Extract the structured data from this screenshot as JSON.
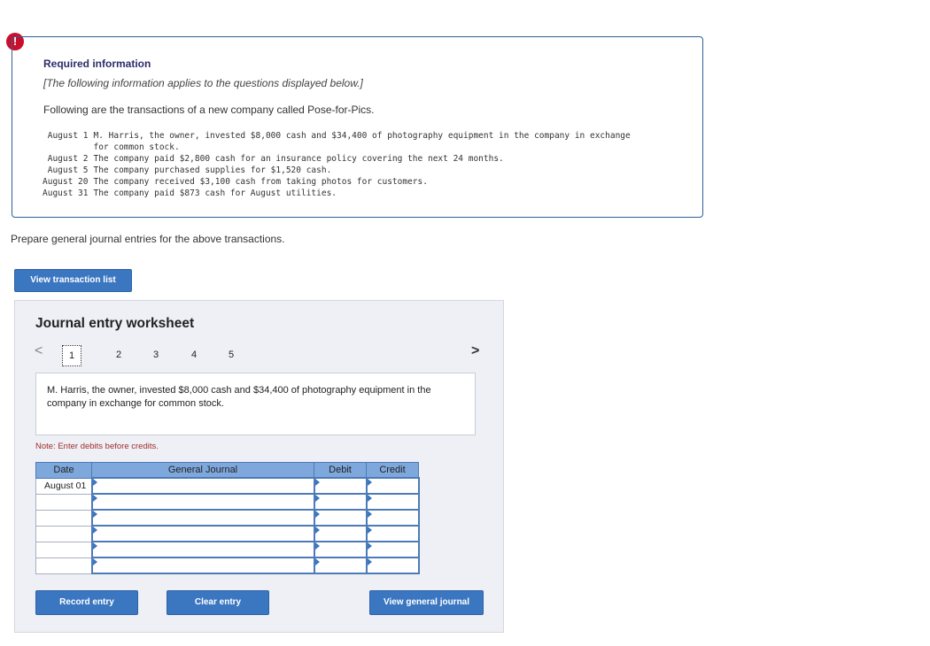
{
  "alert": {
    "symbol": "!"
  },
  "info": {
    "title": "Required information",
    "note": "[The following information applies to the questions displayed below.]",
    "intro": "Following are the transactions of a new company called Pose-for-Pics.",
    "transactions": [
      {
        "date": "August 1",
        "lines": [
          "M. Harris, the owner, invested $8,000 cash and $34,400 of photography equipment in the company in exchange",
          "for common stock."
        ]
      },
      {
        "date": "August 2",
        "lines": [
          "The company paid $2,800 cash for an insurance policy covering the next 24 months."
        ]
      },
      {
        "date": "August 5",
        "lines": [
          "The company purchased supplies for $1,520 cash."
        ]
      },
      {
        "date": "August 20",
        "lines": [
          "The company received $3,100 cash from taking photos for customers."
        ]
      },
      {
        "date": "August 31",
        "lines": [
          "The company paid $873 cash for August utilities."
        ]
      }
    ]
  },
  "prompt": "Prepare general journal entries for the above transactions.",
  "buttons": {
    "view_transaction_list": "View transaction list",
    "record_entry": "Record entry",
    "clear_entry": "Clear entry",
    "view_general_journal": "View general journal"
  },
  "worksheet": {
    "title": "Journal entry worksheet",
    "prev": "<",
    "next": ">",
    "pages": [
      "1",
      "2",
      "3",
      "4",
      "5"
    ],
    "active_page": "1",
    "description": "M. Harris, the owner, invested $8,000 cash and $34,400 of photography equipment in the company in exchange for common stock.",
    "note": "Note: Enter debits before credits.",
    "columns": {
      "date": "Date",
      "general_journal": "General Journal",
      "debit": "Debit",
      "credit": "Credit"
    },
    "rows": [
      {
        "date": "August 01",
        "account": "",
        "debit": "",
        "credit": ""
      },
      {
        "date": "",
        "account": "",
        "debit": "",
        "credit": ""
      },
      {
        "date": "",
        "account": "",
        "debit": "",
        "credit": ""
      },
      {
        "date": "",
        "account": "",
        "debit": "",
        "credit": ""
      },
      {
        "date": "",
        "account": "",
        "debit": "",
        "credit": ""
      },
      {
        "date": "",
        "account": "",
        "debit": "",
        "credit": ""
      }
    ]
  }
}
